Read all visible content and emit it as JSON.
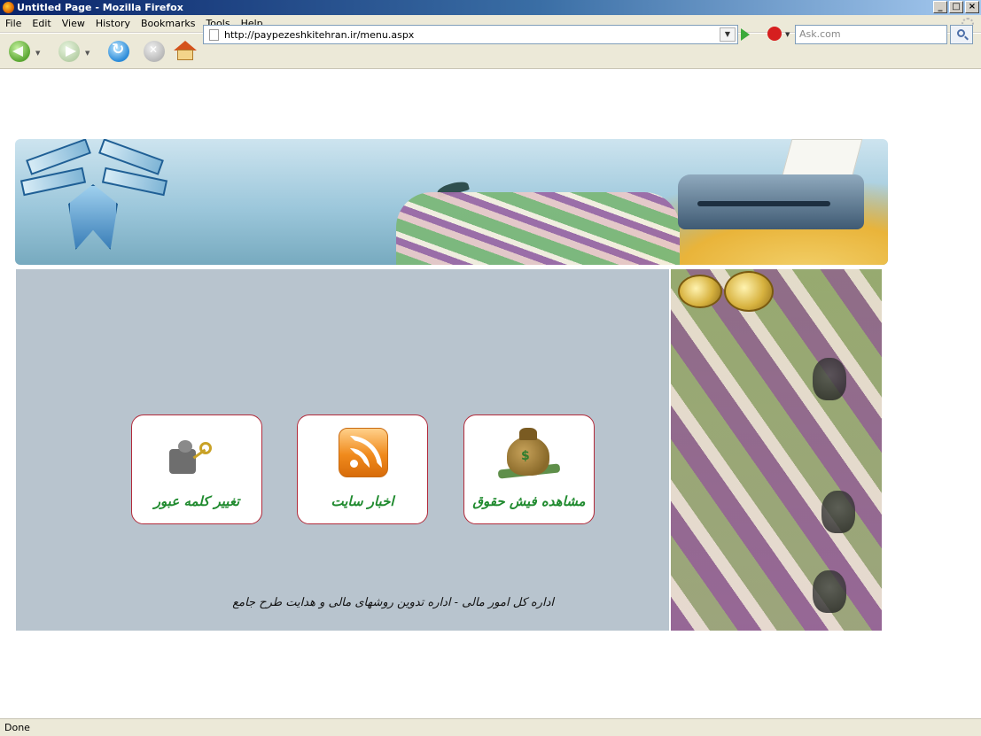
{
  "window": {
    "title": "Untitled Page - Mozilla Firefox",
    "controls": {
      "minimize": "_",
      "maximize": "□",
      "close": "×"
    }
  },
  "menu": {
    "items": [
      "File",
      "Edit",
      "View",
      "History",
      "Bookmarks",
      "Tools",
      "Help"
    ]
  },
  "navigation": {
    "url": "http://paypezeshkitehran.ir/menu.aspx",
    "search_placeholder": "Ask.com",
    "icons": [
      "back-icon",
      "forward-icon",
      "reload-icon",
      "stop-icon",
      "home-icon",
      "go-icon",
      "ask-logo-icon",
      "search-icon"
    ]
  },
  "content": {
    "tiles": [
      {
        "label": "تغییر کلمه عبور",
        "icon": "puzzle-key-icon"
      },
      {
        "label": "اخبار سایت",
        "icon": "rss-icon"
      },
      {
        "label": "مشاهده فیش حقوق",
        "icon": "money-bag-icon"
      }
    ],
    "footer": "اداره کل امور مالی - اداره تدوین روشهای مالی و هدایت طرح جامع"
  },
  "colors": {
    "panel_bg": "#b8c4ce",
    "tile_border": "#b22a3a",
    "tile_label": "#1f8a2e"
  },
  "status": {
    "text": "Done"
  }
}
